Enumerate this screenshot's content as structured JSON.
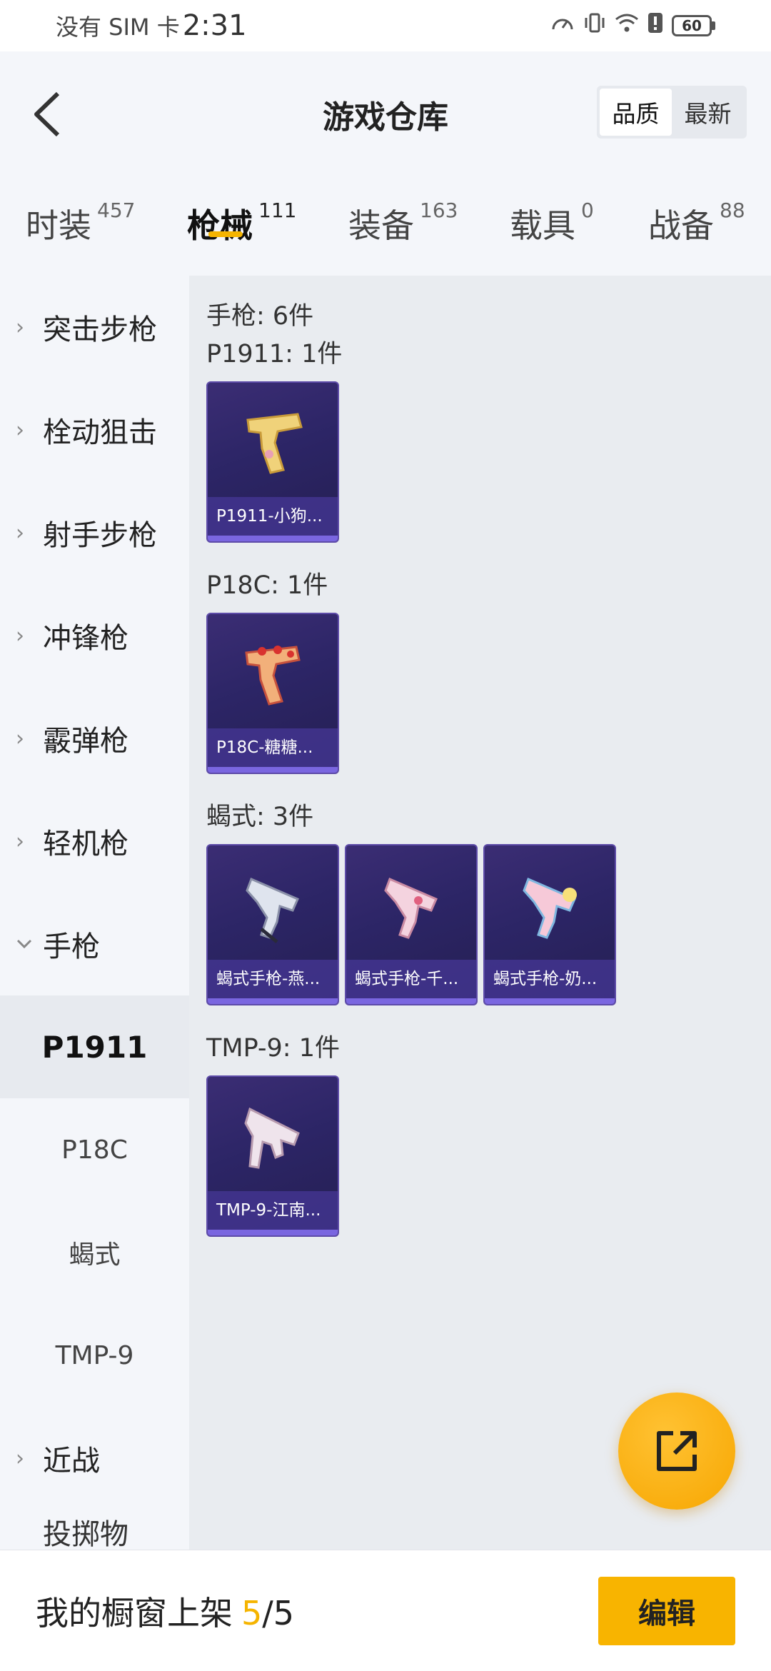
{
  "status_bar": {
    "carrier": "没有 SIM 卡",
    "time": "2:31",
    "battery": "60"
  },
  "header": {
    "title": "游戏仓库",
    "sort_options": [
      "品质",
      "最新"
    ],
    "active_sort": "品质"
  },
  "tabs": [
    {
      "label": "时装",
      "count": "457"
    },
    {
      "label": "枪械",
      "count": "111",
      "active": true
    },
    {
      "label": "装备",
      "count": "163"
    },
    {
      "label": "载具",
      "count": "0"
    },
    {
      "label": "战备",
      "count": "88"
    }
  ],
  "sidebar": {
    "categories": [
      "突击步枪",
      "栓动狙击",
      "射手步枪",
      "冲锋枪",
      "霰弹枪",
      "轻机枪",
      "手枪"
    ],
    "expanded_category": "手枪",
    "subitems": [
      "P1911",
      "P18C",
      "蝎式",
      "TMP-9"
    ],
    "active_subitem": "P1911",
    "after_categories": [
      "近战"
    ],
    "partial_next": "投掷物"
  },
  "content": {
    "total_label": "手枪: 6件",
    "groups": [
      {
        "title": "P1911: 1件",
        "items": [
          {
            "name": "P1911-小狗..."
          }
        ]
      },
      {
        "title": "P18C: 1件",
        "items": [
          {
            "name": "P18C-糖糖..."
          }
        ]
      },
      {
        "title": "蝎式: 3件",
        "items": [
          {
            "name": "蝎式手枪-燕..."
          },
          {
            "name": "蝎式手枪-千..."
          },
          {
            "name": "蝎式手枪-奶..."
          }
        ]
      },
      {
        "title": "TMP-9: 1件",
        "items": [
          {
            "name": "TMP-9-江南..."
          }
        ]
      }
    ]
  },
  "bottom_bar": {
    "label": "我的橱窗上架",
    "shown": "5",
    "separator": "/",
    "total": "5",
    "edit_label": "编辑"
  },
  "colors": {
    "accent": "#f5b400",
    "card_bg": "#2c2566",
    "card_label_bg": "#46379a"
  }
}
